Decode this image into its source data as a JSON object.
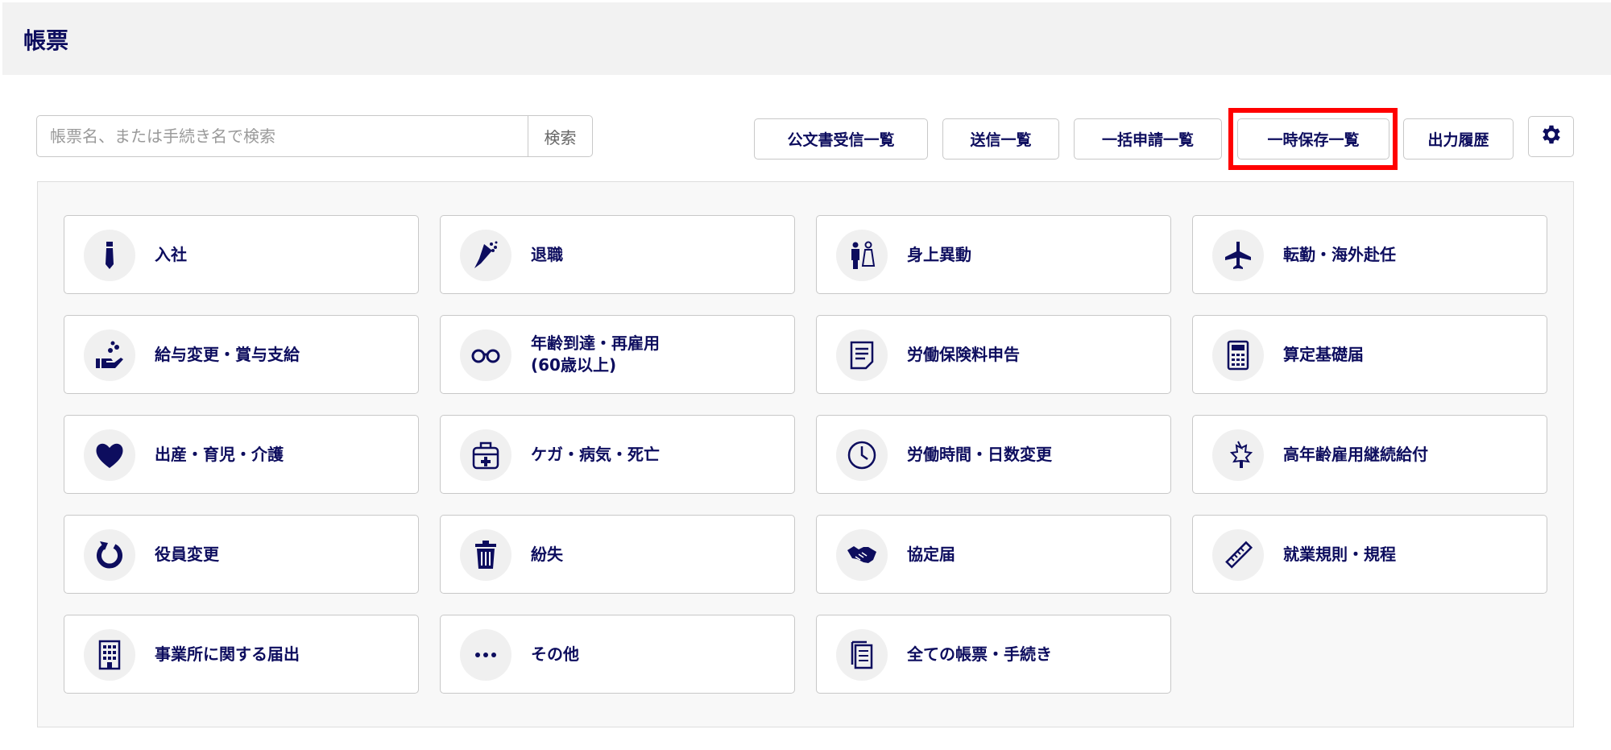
{
  "header": {
    "title": "帳票"
  },
  "search": {
    "placeholder": "帳票名、または手続き名で検索",
    "value": "",
    "button_label": "検索"
  },
  "toolbar": {
    "buttons": [
      {
        "label": "公文書受信一覧"
      },
      {
        "label": "送信一覧"
      },
      {
        "label": "一括申請一覧"
      },
      {
        "label": "一時保存一覧",
        "highlighted": true
      },
      {
        "label": "出力履歴"
      }
    ],
    "settings_icon": "gear-icon"
  },
  "colors": {
    "accent": "#0d0d5e",
    "highlight": "#ff0000"
  },
  "categories": [
    {
      "label": "入社",
      "icon": "necktie"
    },
    {
      "label": "退職",
      "icon": "bouquet"
    },
    {
      "label": "身上異動",
      "icon": "wedding-couple"
    },
    {
      "label": "転勤・海外赴任",
      "icon": "airplane"
    },
    {
      "label": "給与変更・賞与支給",
      "icon": "hand-coins"
    },
    {
      "label": "年齢到達・再雇用\n(60歳以上)",
      "icon": "glasses"
    },
    {
      "label": "労働保険料申告",
      "icon": "document"
    },
    {
      "label": "算定基礎届",
      "icon": "calculator"
    },
    {
      "label": "出産・育児・介護",
      "icon": "heart"
    },
    {
      "label": "ケガ・病気・死亡",
      "icon": "first-aid-kit"
    },
    {
      "label": "労働時間・日数変更",
      "icon": "clock"
    },
    {
      "label": "高年齢雇用継続給付",
      "icon": "maple-leaf"
    },
    {
      "label": "役員変更",
      "icon": "refresh"
    },
    {
      "label": "紛失",
      "icon": "trash"
    },
    {
      "label": "協定届",
      "icon": "handshake"
    },
    {
      "label": "就業規則・規程",
      "icon": "ruler"
    },
    {
      "label": "事業所に関する届出",
      "icon": "building"
    },
    {
      "label": "その他",
      "icon": "more"
    },
    {
      "label": "全ての帳票・手続き",
      "icon": "documents"
    }
  ]
}
